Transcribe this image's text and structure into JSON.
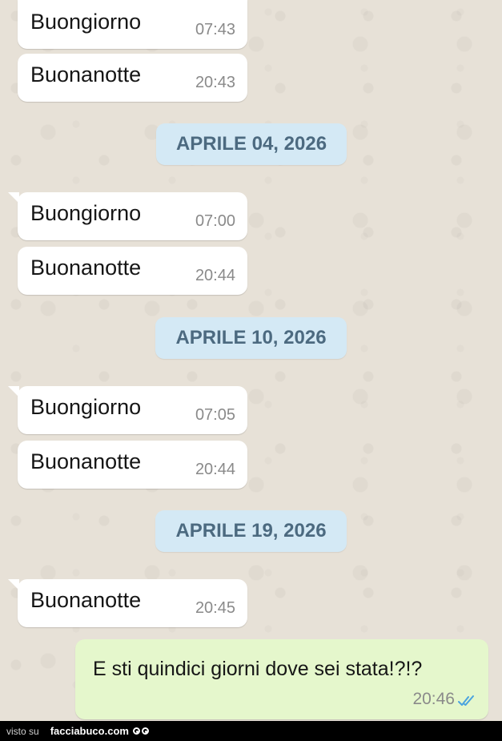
{
  "messages": [
    {
      "text": "Buongiorno",
      "time": "07:43"
    },
    {
      "text": "Buonanotte",
      "time": "20:43"
    },
    {
      "text": "Buongiorno",
      "time": "07:00"
    },
    {
      "text": "Buonanotte",
      "time": "20:44"
    },
    {
      "text": "Buongiorno",
      "time": "07:05"
    },
    {
      "text": "Buonanotte",
      "time": "20:44"
    },
    {
      "text": "Buonanotte",
      "time": "20:45"
    }
  ],
  "dates": [
    "APRILE 04, 2026",
    "APRILE 10, 2026",
    "APRILE 19, 2026"
  ],
  "outgoing": {
    "text": "E sti quindici giorni dove sei stata!?!?",
    "time": "20:46",
    "status_icon": "double-check-read-icon"
  },
  "footer": {
    "label": "visto su",
    "brand": "facciabuco.com"
  },
  "colors": {
    "incoming_bubble": "#ffffff",
    "outgoing_bubble": "#e5f7cc",
    "date_chip": "#d4e9f5",
    "date_text": "#4c6a80",
    "read_ticks": "#4aa3df",
    "wallpaper": "#e7e1d7"
  }
}
